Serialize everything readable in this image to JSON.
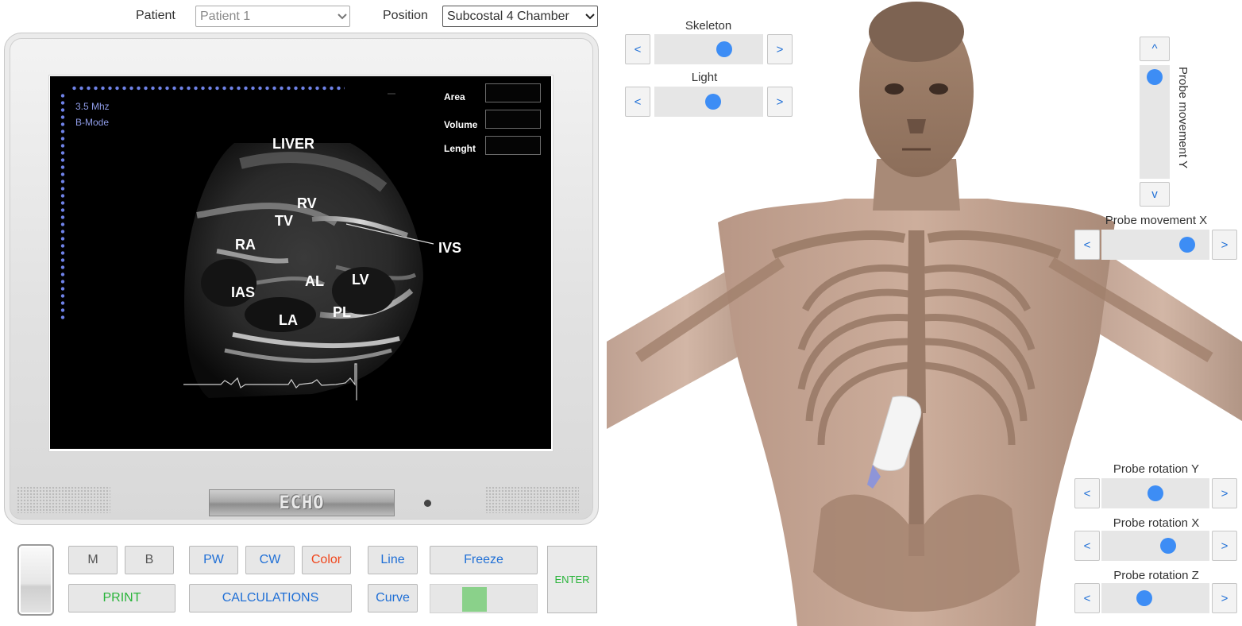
{
  "header": {
    "patient_label": "Patient",
    "patient_value": "Patient 1",
    "position_label": "Position",
    "position_value": "Subcostal 4 Chamber"
  },
  "echo_screen": {
    "frequency": "3.5 Mhz",
    "mode": "B-Mode",
    "measurements": {
      "area_label": "Area",
      "volume_label": "Volume",
      "length_label": "Lenght"
    },
    "labels": {
      "liver": "LIVER",
      "rv": "RV",
      "tv": "TV",
      "ra": "RA",
      "ivs": "IVS",
      "al": "AL",
      "lv": "LV",
      "ias": "IAS",
      "la": "LA",
      "pl": "PL"
    }
  },
  "monitor": {
    "logo": "ECHO"
  },
  "controls": {
    "m": "M",
    "b": "B",
    "pw": "PW",
    "cw": "CW",
    "color": "Color",
    "line": "Line",
    "freeze": "Freeze",
    "print": "PRINT",
    "calculations": "CALCULATIONS",
    "curve": "Curve",
    "enter": "ENTER"
  },
  "sliders": {
    "prev_symbol": "<",
    "next_symbol": ">",
    "up_symbol": "^",
    "down_symbol": "v",
    "skeleton": {
      "label": "Skeleton",
      "level": 0.68
    },
    "light": {
      "label": "Light",
      "level": 0.55
    },
    "probe_movement_y": {
      "label": "Probe movement Y",
      "level": 0.0
    },
    "probe_movement_x": {
      "label": "Probe movement X",
      "level": 0.88
    },
    "probe_rotation_y": {
      "label": "Probe rotation Y",
      "level": 0.5
    },
    "probe_rotation_x": {
      "label": "Probe rotation X",
      "level": 0.65
    },
    "probe_rotation_z": {
      "label": "Probe rotation Z",
      "level": 0.37
    }
  },
  "colors": {
    "accent_blue": "#1f6fd6",
    "thumb_blue": "#3d8df5",
    "green": "#29b43a",
    "red": "#f0461c"
  }
}
